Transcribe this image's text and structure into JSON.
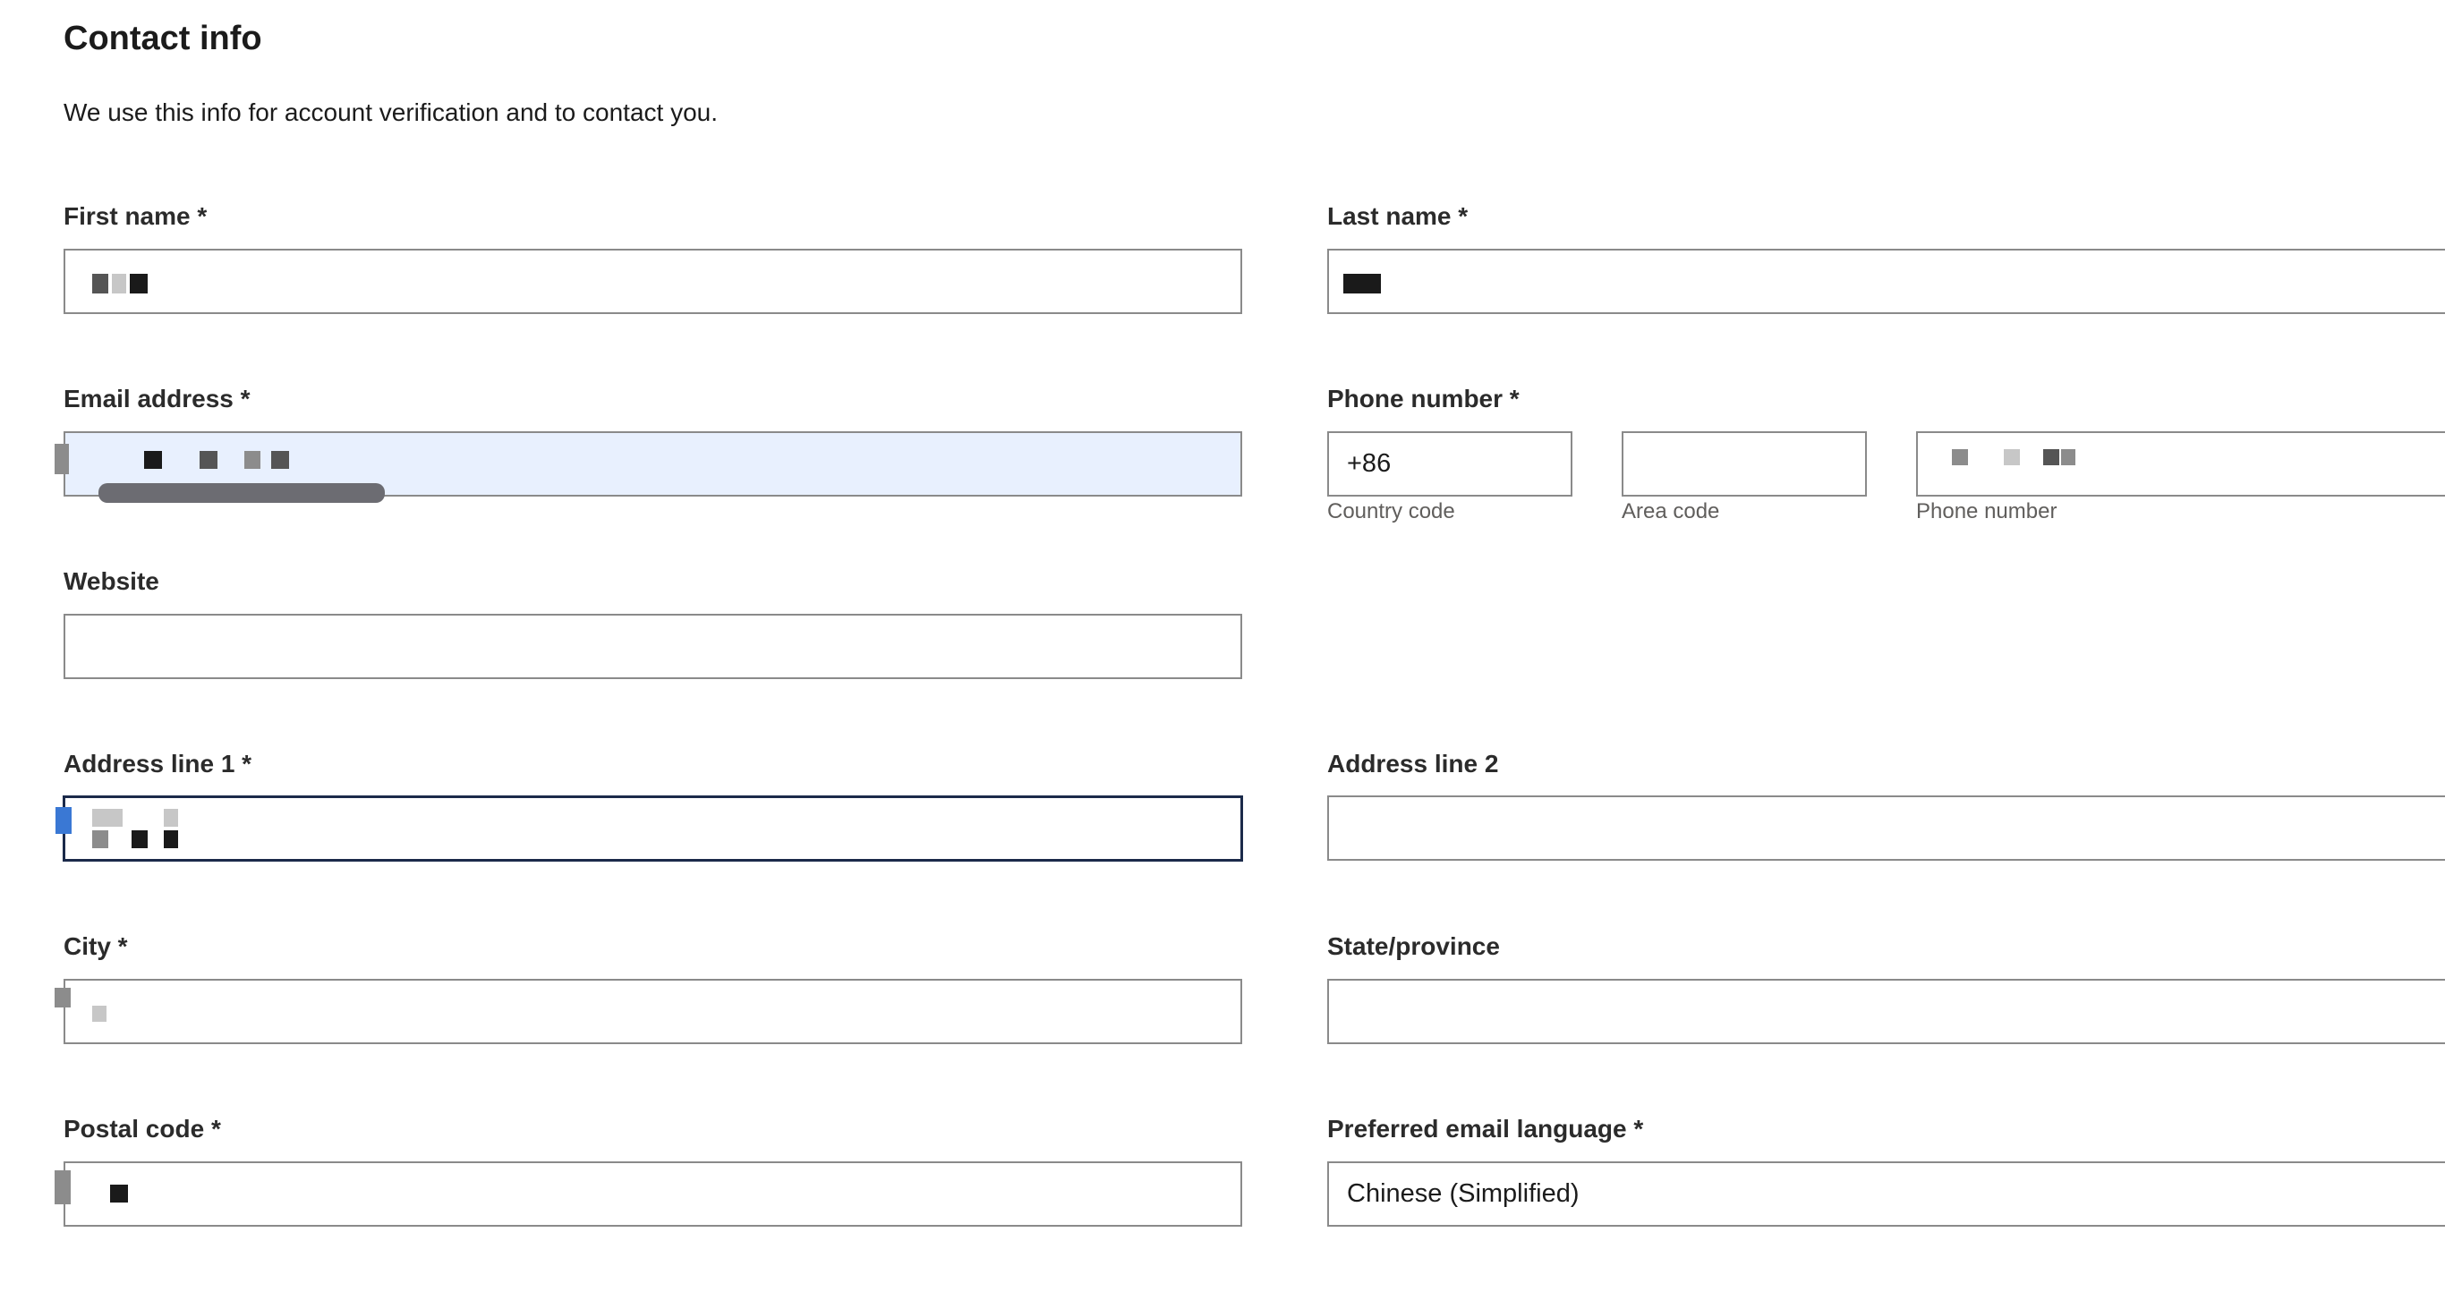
{
  "section": {
    "title": "Contact info",
    "subtitle": "We use this info for account verification and to contact you."
  },
  "fields": {
    "first_name": {
      "label": "First name *",
      "value": ""
    },
    "last_name": {
      "label": "Last name *",
      "value": ""
    },
    "email": {
      "label": "Email address *",
      "value": ""
    },
    "phone": {
      "label": "Phone number *",
      "country_code": {
        "value": "+86",
        "sublabel": "Country code"
      },
      "area_code": {
        "value": "",
        "sublabel": "Area code"
      },
      "number": {
        "value": "",
        "sublabel": "Phone number"
      }
    },
    "website": {
      "label": "Website",
      "value": ""
    },
    "address1": {
      "label": "Address line 1 *",
      "value": ""
    },
    "address2": {
      "label": "Address line 2",
      "value": ""
    },
    "city": {
      "label": "City *",
      "value": ""
    },
    "state": {
      "label": "State/province",
      "value": ""
    },
    "postal": {
      "label": "Postal code *",
      "value": ""
    },
    "language": {
      "label": "Preferred email language *",
      "value": "Chinese (Simplified)"
    }
  }
}
